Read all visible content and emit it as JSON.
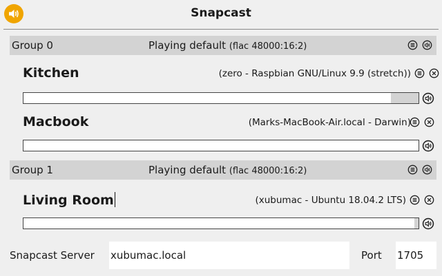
{
  "header": {
    "title": "Snapcast"
  },
  "groups": [
    {
      "name": "Group 0",
      "status": "Playing default",
      "codec": "(flac 48000:16:2)",
      "clients": [
        {
          "name": "Kitchen",
          "host": "(zero - Raspbian GNU/Linux 9.9 (stretch))",
          "volume": 0.93
        },
        {
          "name": "Macbook",
          "host": "(Marks-MacBook-Air.local - Darwin)",
          "volume": 1.0
        }
      ]
    },
    {
      "name": "Group 1",
      "status": "Playing default",
      "codec": "(flac 48000:16:2)",
      "clients": [
        {
          "name": "Living Room",
          "host": "(xubumac - Ubuntu 18.04.2 LTS)",
          "volume": 0.99
        }
      ]
    }
  ],
  "footer": {
    "server_label": "Snapcast Server",
    "server_value": "xubumac.local",
    "port_label": "Port",
    "port_value": "1705"
  },
  "icons": {
    "speaker": "speaker-icon",
    "menu": "menu-icon",
    "volume": "volume-icon",
    "remove": "remove-icon"
  },
  "colors": {
    "accent": "#f0a500",
    "group_bar": "#d3d3d3",
    "slider_track": "#d3d3d3",
    "slider_fill": "#ffffff"
  }
}
